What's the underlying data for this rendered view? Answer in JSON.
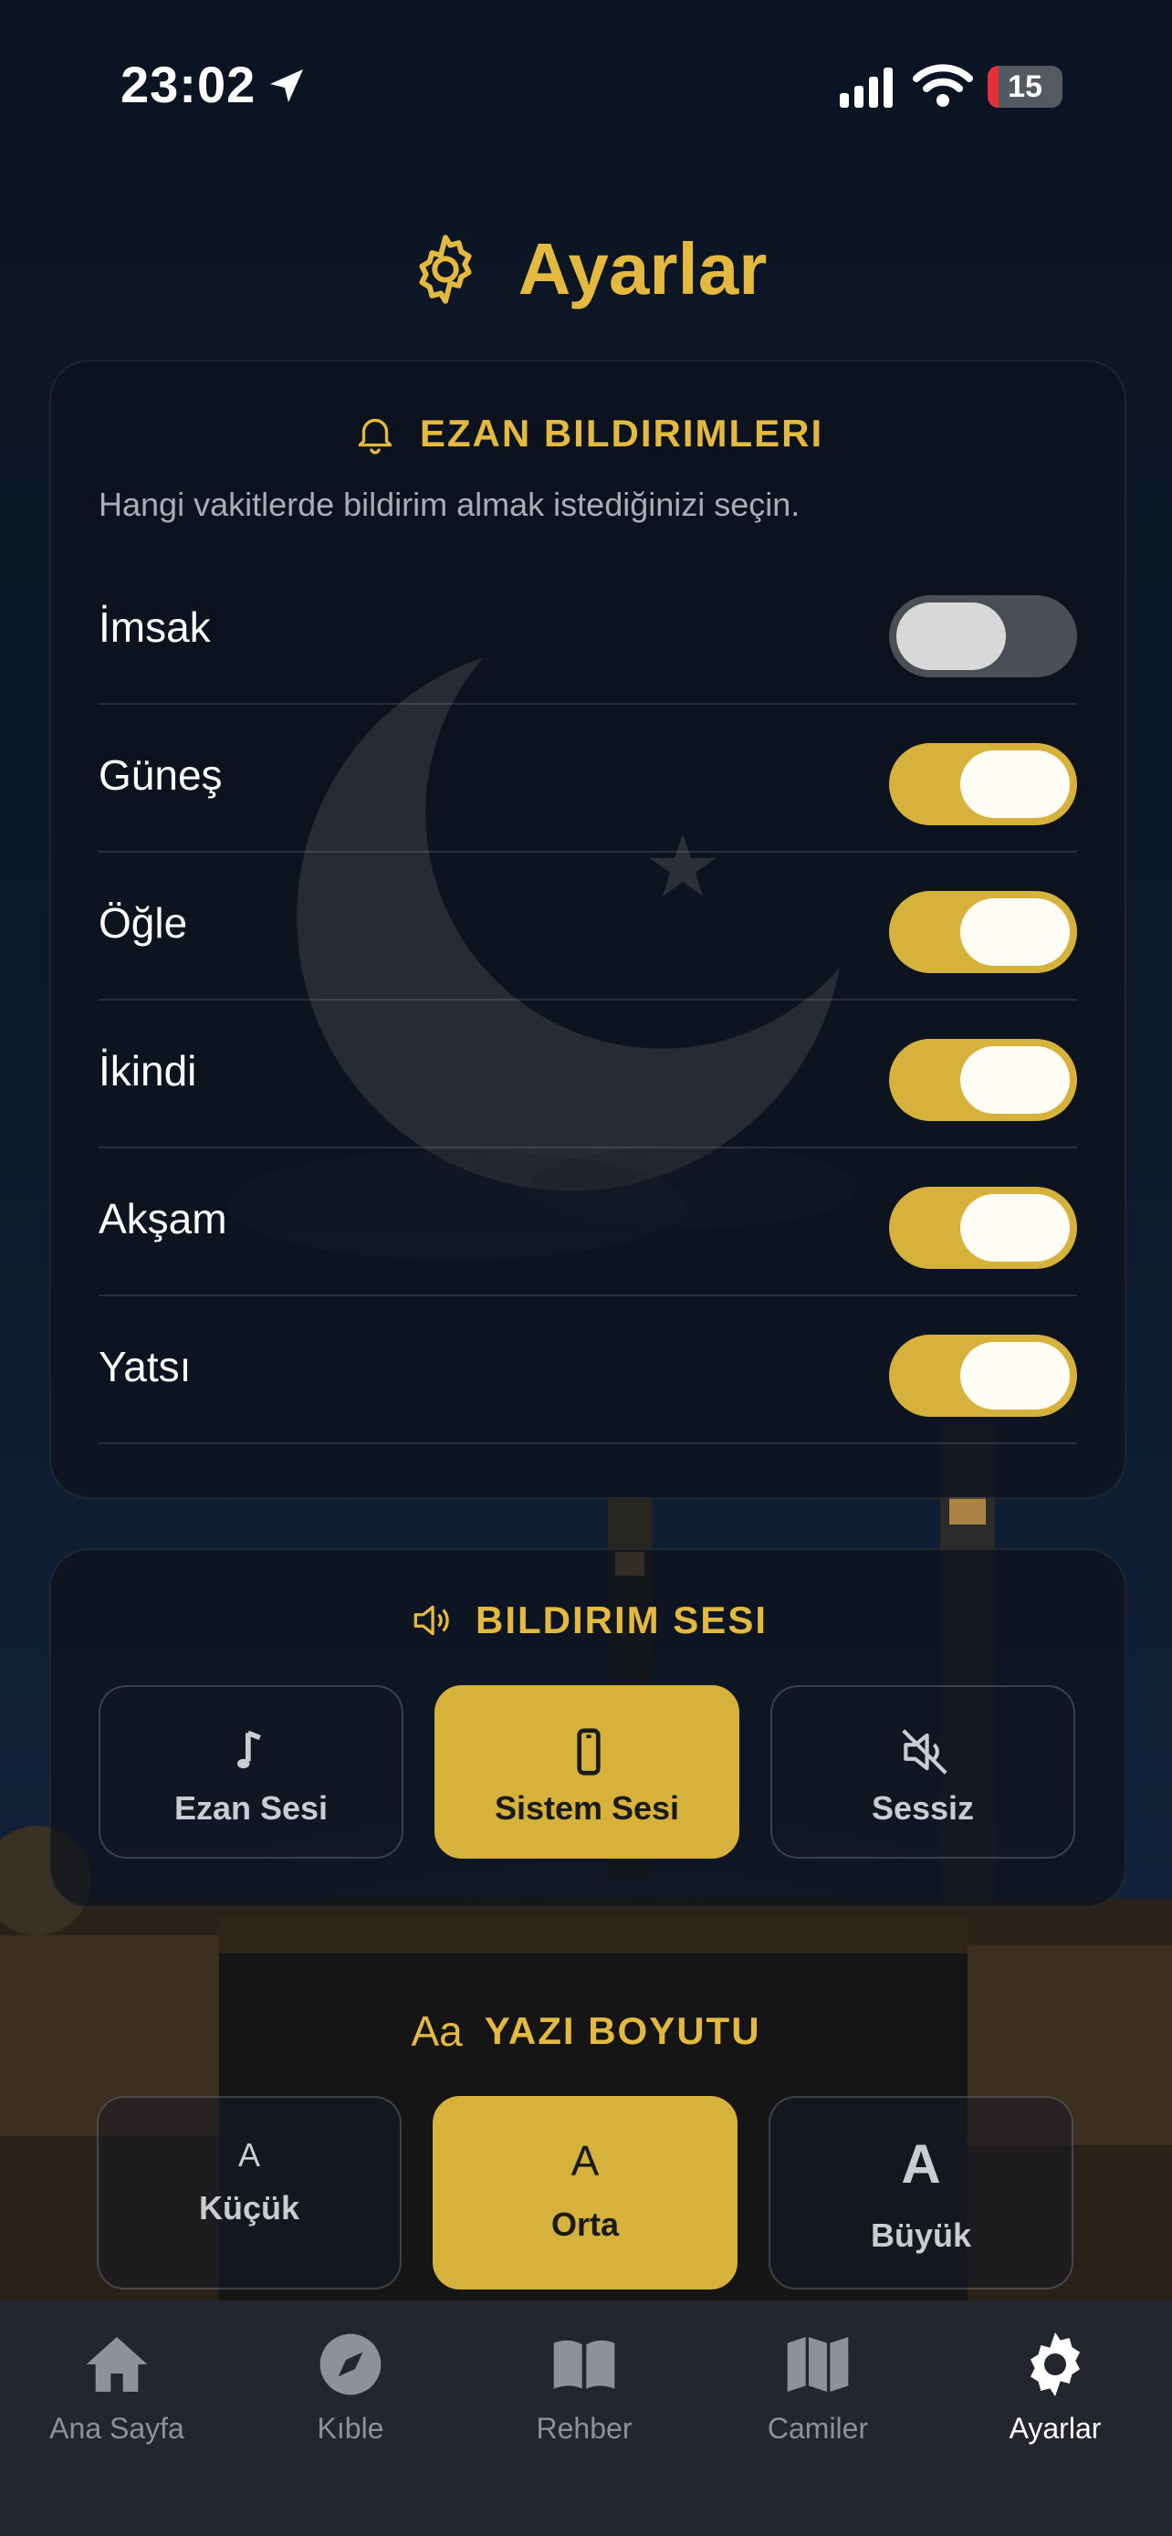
{
  "status_bar": {
    "time": "23:02",
    "battery": "15"
  },
  "header": {
    "title": "Ayarlar"
  },
  "notifications": {
    "title": "EZAN BILDIRIMLERI",
    "description": "Hangi vakitlerde bildirim almak istediğinizi seçin.",
    "items": [
      {
        "label": "İmsak",
        "enabled": false
      },
      {
        "label": "Güneş",
        "enabled": true
      },
      {
        "label": "Öğle",
        "enabled": true
      },
      {
        "label": "İkindi",
        "enabled": true
      },
      {
        "label": "Akşam",
        "enabled": true
      },
      {
        "label": "Yatsı",
        "enabled": true
      }
    ]
  },
  "sound": {
    "title": "BILDIRIM SESI",
    "options": [
      {
        "label": "Ezan Sesi",
        "icon": "music-note-icon",
        "selected": false
      },
      {
        "label": "Sistem Sesi",
        "icon": "phone-icon",
        "selected": true
      },
      {
        "label": "Sessiz",
        "icon": "mute-icon",
        "selected": false
      }
    ]
  },
  "font_size": {
    "title_prefix": "Aa",
    "title": "YAZI BOYUTU",
    "options": [
      {
        "letter": "A",
        "label": "Küçük",
        "selected": false
      },
      {
        "letter": "A",
        "label": "Orta",
        "selected": true
      },
      {
        "letter": "A",
        "label": "Büyük",
        "selected": false
      }
    ]
  },
  "tabs": [
    {
      "label": "Ana Sayfa",
      "icon": "home-icon",
      "active": false
    },
    {
      "label": "Kıble",
      "icon": "compass-icon",
      "active": false
    },
    {
      "label": "Rehber",
      "icon": "book-icon",
      "active": false
    },
    {
      "label": "Camiler",
      "icon": "map-icon",
      "active": false
    },
    {
      "label": "Ayarlar",
      "icon": "gear-icon",
      "active": true
    }
  ],
  "colors": {
    "accent": "#d6b13b",
    "title": "#e3b93f",
    "card": "#0c121c",
    "tab_bar": "#23272d"
  }
}
